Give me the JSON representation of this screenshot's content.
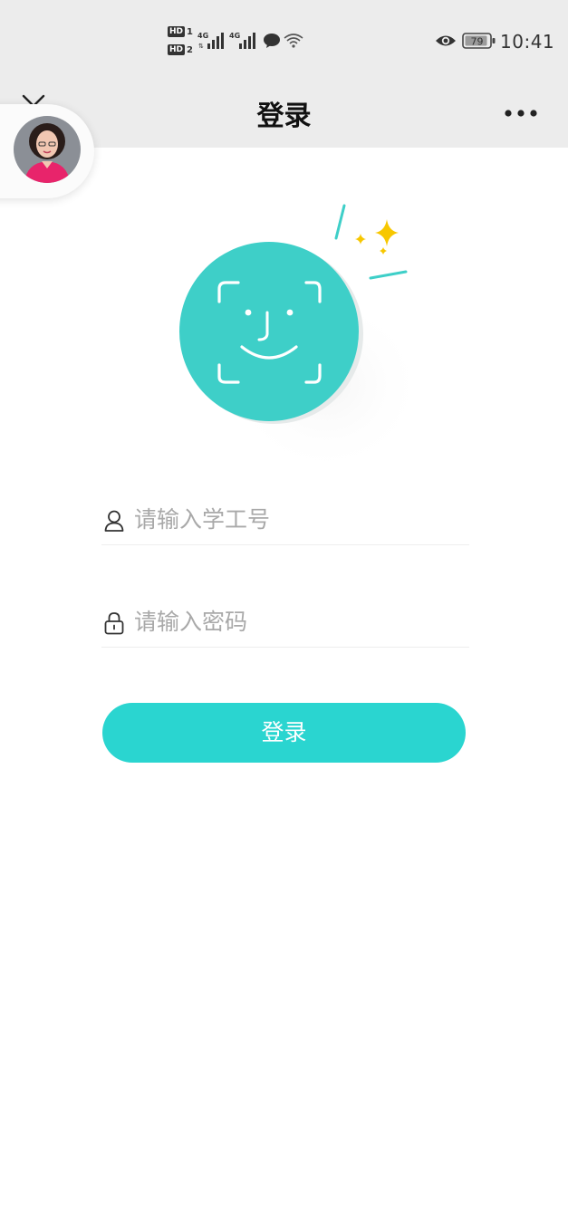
{
  "status_bar": {
    "time": "10:41",
    "battery": "79",
    "sim1_label": "HD",
    "sim1_num": "1",
    "sim2_label": "HD",
    "sim2_num": "2",
    "network1": "4G",
    "network2": "4G",
    "icons": [
      "hd-sim-icon",
      "signal-icon",
      "wechat-icon",
      "wifi-icon",
      "eye-icon",
      "battery-icon"
    ]
  },
  "nav": {
    "title": "登录",
    "icons": [
      "close-icon",
      "more-icon"
    ]
  },
  "form": {
    "username_placeholder": "请输入学工号",
    "username_value": "",
    "password_placeholder": "请输入密码",
    "password_value": "",
    "login_label": "登录",
    "icons": [
      "user-icon",
      "lock-icon"
    ]
  },
  "colors": {
    "accent": "#2ad5d0",
    "face_circle": "#3ecfc8",
    "sparkle": "#f7c700",
    "navbar_bg": "#ececec",
    "placeholder": "#a9a9a9"
  }
}
